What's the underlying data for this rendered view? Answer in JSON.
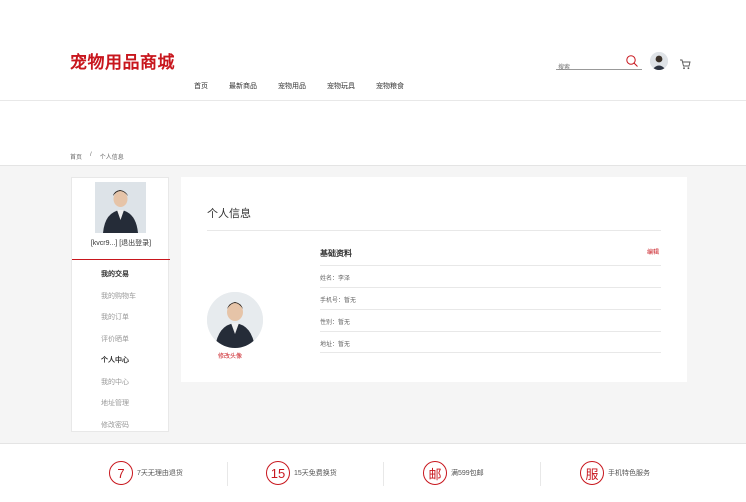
{
  "header": {
    "logo": "宠物用品商城",
    "nav": [
      "首页",
      "最新商品",
      "宠物用品",
      "宠物玩具",
      "宠物粮食"
    ],
    "search_placeholder": "搜索"
  },
  "breadcrumb": [
    "首页",
    "/",
    "个人信息"
  ],
  "sidebar": {
    "user_label": "[kvcr9...] [退出登录]",
    "menu": [
      {
        "label": "我的交易",
        "head": true
      },
      {
        "label": "我的购物车",
        "head": false
      },
      {
        "label": "我的订单",
        "head": false
      },
      {
        "label": "评价晒单",
        "head": false
      },
      {
        "label": "个人中心",
        "head": true
      },
      {
        "label": "我的中心",
        "head": false
      },
      {
        "label": "地址管理",
        "head": false
      },
      {
        "label": "修改密码",
        "head": false
      }
    ]
  },
  "panel": {
    "title": "个人信息",
    "change_avatar": "修改头像",
    "info_title": "基础资料",
    "edit": "编辑",
    "rows": [
      "姓名：李泽",
      "手机号：暂无",
      "性别：暂无",
      "地址：暂无"
    ]
  },
  "footer": {
    "services": [
      {
        "badge": "7",
        "text": "7天无理由退货"
      },
      {
        "badge": "15",
        "text": "15天免费换货"
      },
      {
        "badge": "邮",
        "text": "满599包邮"
      },
      {
        "badge": "服",
        "text": "手机特色服务"
      }
    ]
  },
  "colors": {
    "accent": "#c8161d",
    "background": "#f5f5f5"
  },
  "icons": [
    "search-icon",
    "cart-icon",
    "avatar"
  ]
}
